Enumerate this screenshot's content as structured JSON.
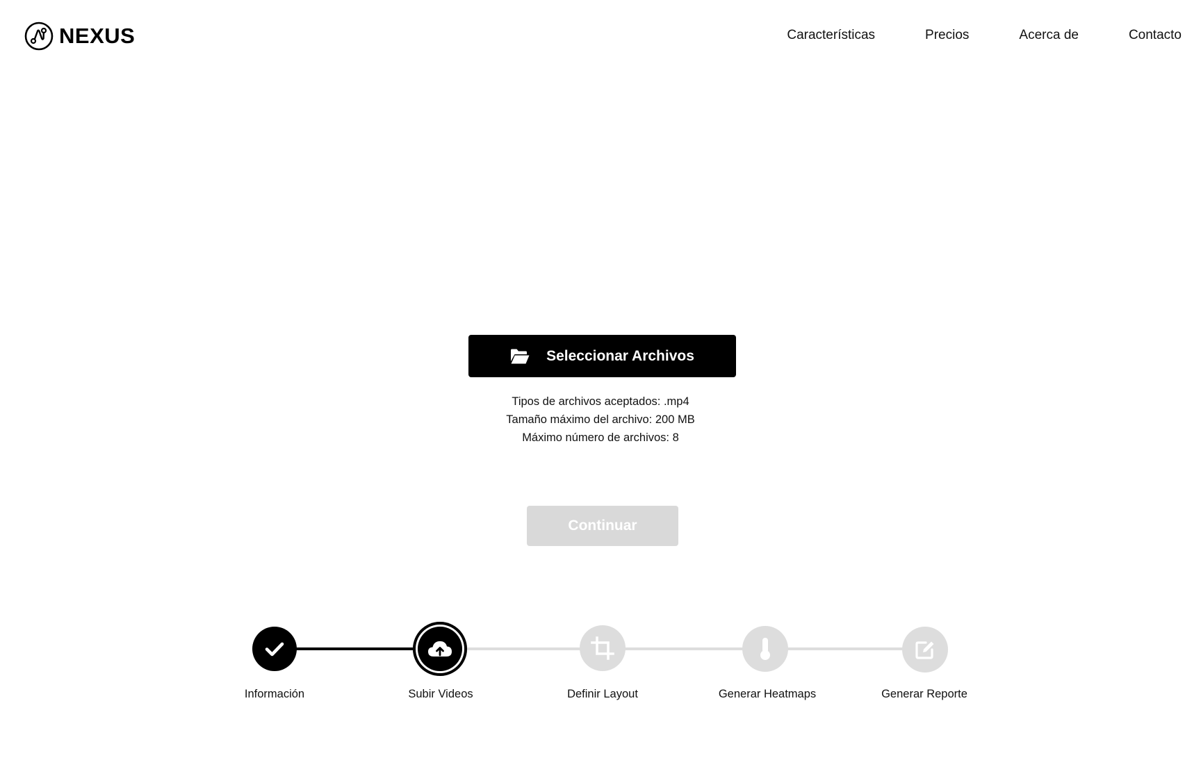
{
  "header": {
    "brand": "NEXUS",
    "nav": [
      "Características",
      "Precios",
      "Acerca de",
      "Contacto"
    ]
  },
  "upload": {
    "select_label": "Seleccionar Archivos",
    "accepted_types": "Tipos de archivos aceptados: .mp4",
    "max_size": "Tamaño máximo del archivo: 200 MB",
    "max_files": "Máximo número de archivos: 8",
    "continue_label": "Continuar"
  },
  "stepper": {
    "steps": [
      {
        "label": "Información",
        "state": "done",
        "icon": "check-icon"
      },
      {
        "label": "Subir Videos",
        "state": "current",
        "icon": "cloud-upload-icon"
      },
      {
        "label": "Definir Layout",
        "state": "todo",
        "icon": "crop-icon"
      },
      {
        "label": "Generar Heatmaps",
        "state": "todo",
        "icon": "thermometer-icon"
      },
      {
        "label": "Generar Reporte",
        "state": "todo",
        "icon": "edit-icon"
      }
    ]
  },
  "colors": {
    "primary": "#000000",
    "disabled": "#d9d9d9",
    "inactive_step": "#dddddd",
    "text": "#111111"
  }
}
